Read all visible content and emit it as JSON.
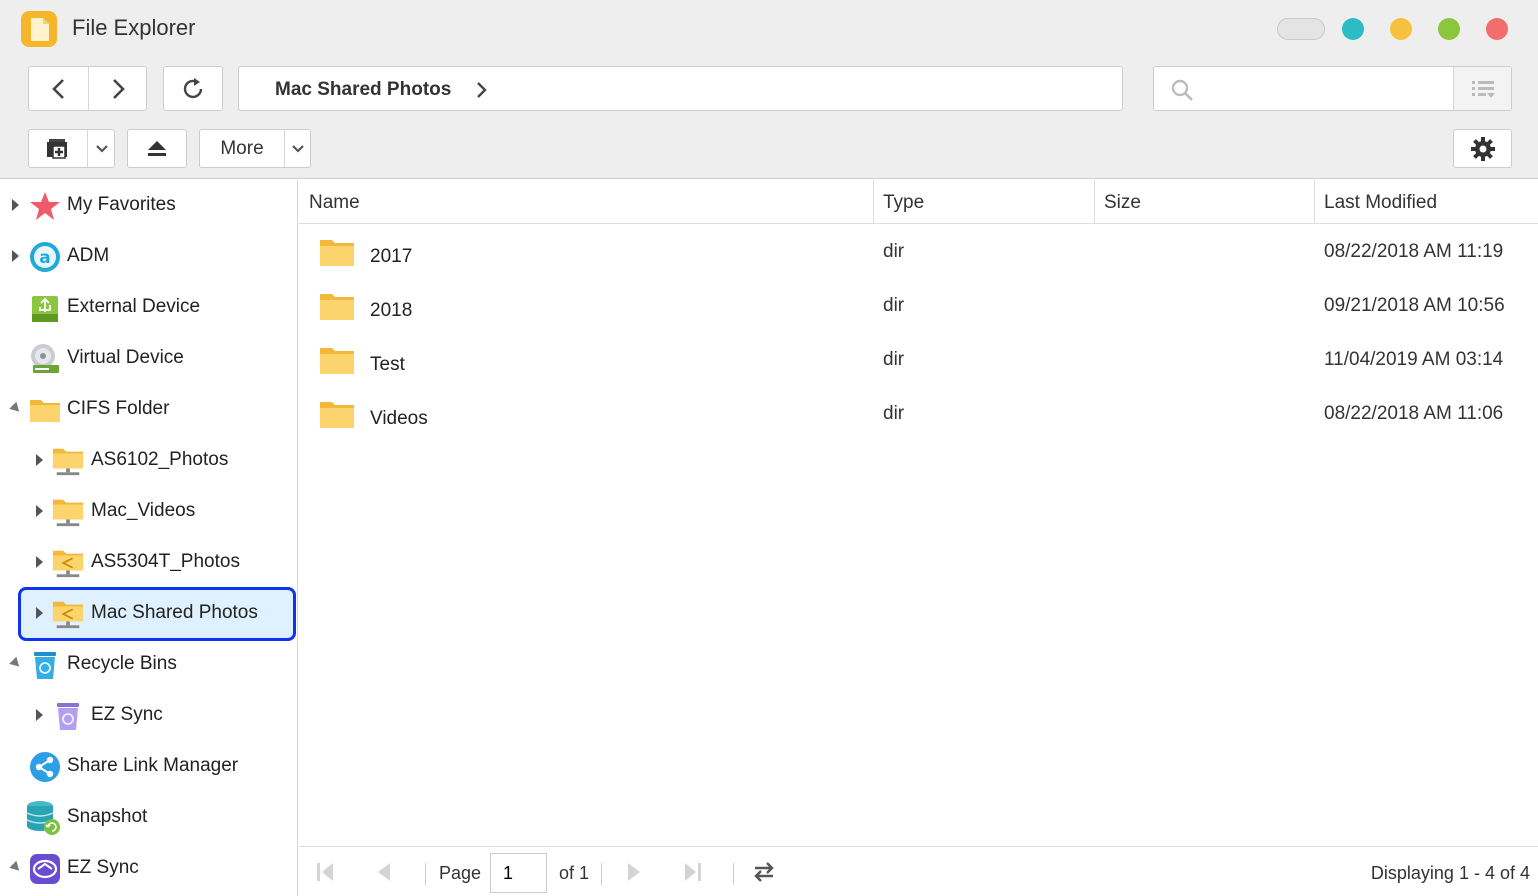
{
  "window": {
    "title": "File Explorer",
    "controls": [
      {
        "name": "pill",
        "color": "#e4e4e4"
      },
      {
        "name": "teal",
        "color": "#2bbcc4"
      },
      {
        "name": "yellow",
        "color": "#f6c23e"
      },
      {
        "name": "green",
        "color": "#8cc63f"
      },
      {
        "name": "red",
        "color": "#f36d6d"
      }
    ]
  },
  "toolbar": {
    "path": "Mac Shared Photos",
    "search_placeholder": "",
    "more_label": "More"
  },
  "sidebar": {
    "items": [
      {
        "label": "My Favorites",
        "icon": "star-icon",
        "arrow": "right",
        "level": 0
      },
      {
        "label": "ADM",
        "icon": "adm-icon",
        "arrow": "right",
        "level": 0
      },
      {
        "label": "External Device",
        "icon": "usb-drive-icon",
        "arrow": "none",
        "level": 0
      },
      {
        "label": "Virtual Device",
        "icon": "disc-drive-icon",
        "arrow": "none",
        "level": 0
      },
      {
        "label": "CIFS Folder",
        "icon": "folder-icon",
        "arrow": "down",
        "level": 0
      },
      {
        "label": "AS6102_Photos",
        "icon": "network-folder-icon",
        "arrow": "right",
        "level": 1
      },
      {
        "label": "Mac_Videos",
        "icon": "network-folder-icon",
        "arrow": "right",
        "level": 1
      },
      {
        "label": "AS5304T_Photos",
        "icon": "shared-network-folder-icon",
        "arrow": "right",
        "level": 1
      },
      {
        "label": "Mac Shared Photos",
        "icon": "shared-network-folder-icon",
        "arrow": "right",
        "level": 1,
        "selected": true
      },
      {
        "label": "Recycle Bins",
        "icon": "recycle-bin-icon",
        "arrow": "down",
        "level": 0
      },
      {
        "label": "EZ Sync",
        "icon": "purple-recycle-bin-icon",
        "arrow": "right",
        "level": 1
      },
      {
        "label": "Share Link Manager",
        "icon": "share-link-icon",
        "arrow": "none",
        "level": 0
      },
      {
        "label": "Snapshot",
        "icon": "snapshot-icon",
        "arrow": "none",
        "level": 0
      },
      {
        "label": "EZ Sync",
        "icon": "ez-sync-icon",
        "arrow": "down",
        "level": 0
      }
    ]
  },
  "grid": {
    "columns": [
      "Name",
      "Type",
      "Size",
      "Last Modified"
    ],
    "rows": [
      {
        "name": "2017",
        "type": "dir",
        "size": "",
        "modified": "08/22/2018 AM 11:19"
      },
      {
        "name": "2018",
        "type": "dir",
        "size": "",
        "modified": "09/21/2018 AM 10:56"
      },
      {
        "name": "Test",
        "type": "dir",
        "size": "",
        "modified": "11/04/2019 AM 03:14"
      },
      {
        "name": "Videos",
        "type": "dir",
        "size": "",
        "modified": "08/22/2018 AM 11:06"
      }
    ]
  },
  "pager": {
    "page_label": "Page",
    "page_value": "1",
    "of_label": "of 1",
    "display_text": "Displaying 1 - 4 of 4"
  }
}
